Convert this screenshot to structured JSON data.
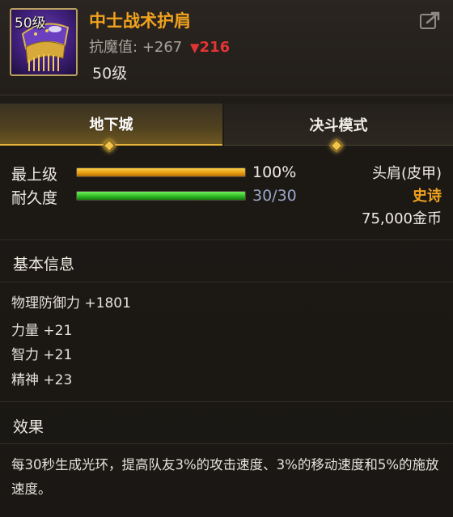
{
  "header": {
    "icon_level_badge": "50级",
    "title": "中士战术护肩",
    "resist_label": "抗魔值:",
    "resist_value": "+267",
    "resist_delta": "216",
    "required_level": "50级"
  },
  "tabs": [
    {
      "label": "地下城",
      "active": true
    },
    {
      "label": "决斗模式",
      "active": false
    }
  ],
  "stats": {
    "max_level_label": "最上级",
    "max_level_value": "100%",
    "max_level_fraction": 1.0,
    "durability_label": "耐久度",
    "durability_value": "30/30",
    "durability_fraction": 1.0
  },
  "item_meta": {
    "slot_type": "头肩(皮甲)",
    "rarity": "史诗",
    "price": "75,000金币"
  },
  "basic_info": {
    "title": "基本信息",
    "attributes": [
      "物理防御力 +1801",
      "力量 +21",
      "智力 +21",
      "精神 +23"
    ]
  },
  "effect": {
    "title": "效果",
    "text": "每30秒生成光环，提高队友3%的攻击速度、3%的移动速度和5%的施放速度。"
  },
  "colors": {
    "title_orange": "#f0a21e",
    "delta_red": "#e23434",
    "bar_orange": "#e59a10",
    "bar_green": "#2bb520",
    "icon_purple": "#4a2590",
    "tab_active_gold": "#e5b23b"
  },
  "icons": {
    "share": "share-icon",
    "item": "shoulder-armor-icon",
    "down_triangle": "down-triangle-icon"
  }
}
